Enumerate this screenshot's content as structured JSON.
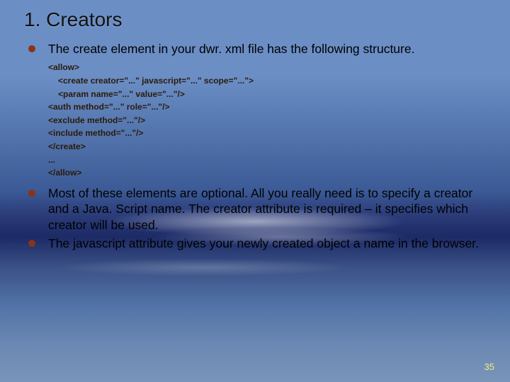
{
  "title": "1. Creators",
  "bullets": {
    "b1": "The create element in your dwr. xml file has the following structure.",
    "b2": "Most of these elements are optional. All you really need is to specify a creator and a Java. Script name. The creator attribute is required – it specifies which creator will be used.",
    "b3": "The javascript attribute gives your newly created object a name in the  browser."
  },
  "code": {
    "l1": "<allow>",
    "l2": "<create creator=\"...\" javascript=\"...\" scope=\"...\">",
    "l3": "<param name=\"...\" value=\"...\"/>",
    "l4": "<auth method=\"...\" role=\"...\"/>",
    "l5": "<exclude method=\"...\"/>",
    "l6": "<include method=\"...\"/>",
    "l7": "</create>",
    "l8": "...",
    "l9": "</allow>"
  },
  "pageNumber": "35"
}
